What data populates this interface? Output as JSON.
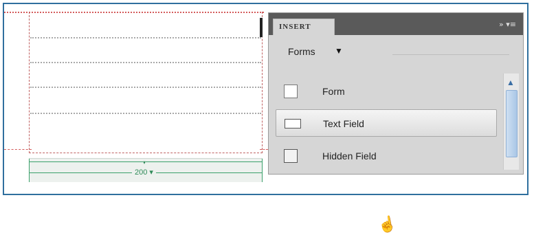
{
  "design_view": {
    "width_label": "200",
    "width_caret": "▾"
  },
  "insert_panel": {
    "tab_label": "INSERT",
    "header_icons": "»  ▾≡",
    "category": "Forms",
    "category_caret": "▼",
    "items": [
      {
        "label": "Form",
        "icon": "form-icon"
      },
      {
        "label": "Text Field",
        "icon": "text-field-icon",
        "selected": true
      },
      {
        "label": "Hidden Field",
        "icon": "hidden-field-icon"
      }
    ],
    "scroll_up_glyph": "▲"
  }
}
